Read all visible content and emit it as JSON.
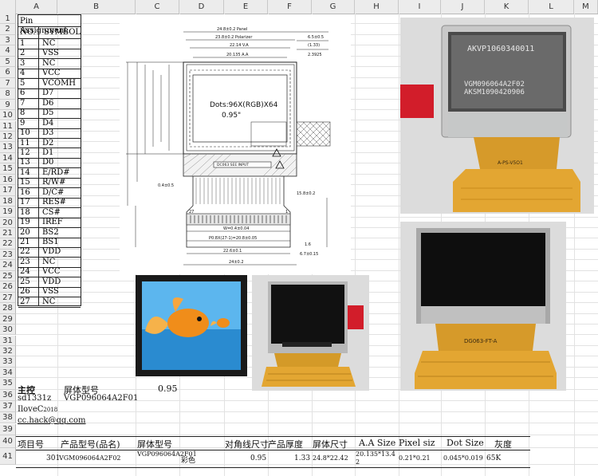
{
  "columns": [
    "A",
    "B",
    "C",
    "D",
    "E",
    "F",
    "G",
    "H",
    "I",
    "J",
    "K",
    "L",
    "M"
  ],
  "rows": [
    "1",
    "2",
    "3",
    "4",
    "5",
    "6",
    "7",
    "8",
    "9",
    "10",
    "11",
    "12",
    "13",
    "14",
    "15",
    "16",
    "17",
    "18",
    "19",
    "20",
    "21",
    "22",
    "23",
    "24",
    "25",
    "26",
    "27",
    "28",
    "29",
    "30",
    "31",
    "32",
    "33",
    "34",
    "35",
    "36",
    "37",
    "38",
    "39",
    "40",
    "41"
  ],
  "pin_table": {
    "title": "Pin Assignment",
    "header_no": "NO.",
    "header_symbol": "SYMBOL",
    "pins": [
      {
        "no": "1",
        "sym": "NC"
      },
      {
        "no": "2",
        "sym": "VSS"
      },
      {
        "no": "3",
        "sym": "NC"
      },
      {
        "no": "4",
        "sym": "VCC"
      },
      {
        "no": "5",
        "sym": "VCOMH"
      },
      {
        "no": "6",
        "sym": "D7"
      },
      {
        "no": "7",
        "sym": "D6"
      },
      {
        "no": "8",
        "sym": "D5"
      },
      {
        "no": "9",
        "sym": "D4"
      },
      {
        "no": "10",
        "sym": "D3"
      },
      {
        "no": "11",
        "sym": "D2"
      },
      {
        "no": "12",
        "sym": "D1"
      },
      {
        "no": "13",
        "sym": "D0"
      },
      {
        "no": "14",
        "sym": "E/RD#"
      },
      {
        "no": "15",
        "sym": "R/W#"
      },
      {
        "no": "16",
        "sym": "D/C#"
      },
      {
        "no": "17",
        "sym": "RES#"
      },
      {
        "no": "18",
        "sym": "CS#"
      },
      {
        "no": "19",
        "sym": "IREF"
      },
      {
        "no": "20",
        "sym": "BS2"
      },
      {
        "no": "21",
        "sym": "BS1"
      },
      {
        "no": "22",
        "sym": "VDD"
      },
      {
        "no": "23",
        "sym": "NC"
      },
      {
        "no": "24",
        "sym": "VCC"
      },
      {
        "no": "25",
        "sym": "VDD"
      },
      {
        "no": "26",
        "sym": "VSS"
      },
      {
        "no": "27",
        "sym": "NC"
      }
    ]
  },
  "drawing": {
    "dim_panel": "24.8±0.2 Panel",
    "dim_polarizer": "23.8±0.2 Polarizer",
    "dim_va": "22.14 V.A",
    "dim_aa": "20.135 A.A",
    "dim_r1": "6.5±0.5",
    "dim_r2": "(1.33)",
    "dim_r3": "2.3925",
    "dots": "Dots:96X(RGB)X64",
    "size": "0.95\"",
    "ic_label": "DC063 SEE INPUT",
    "dim_w1": "W=0.4±0.04",
    "dim_p": "P0.8X(27-1)=20.8±0.05",
    "dim_w2": "22.6±0.1",
    "dim_w3": "24±0.2",
    "dim_side1": "1.6",
    "dim_side2": "6.7±0.15",
    "dim_fpc": "15.8±0.2",
    "dim_stiff": "0.4±0.5",
    "dim_pin27": "27",
    "dim_pin1": "1"
  },
  "photos": {
    "photo1_line1": "AKVP1060340011",
    "photo1_line2": "VGM096064A2F02",
    "photo1_line3": "AKSM1090420906",
    "photo1_fpc": "A-PS-V5O1",
    "photo3_fpc": "DG063-FT-A"
  },
  "cells": {
    "a35": "主控",
    "b35": "屏体型号",
    "c35": "0.95",
    "a36": "sd1331z",
    "b36": "VGP096064A2F01",
    "a37": "IloveC",
    "a37_sup": "2018",
    "a38": "cc.hack@qq.com"
  },
  "spec_table": {
    "headers": [
      "项目号",
      "产品型号(品名)",
      "屏体型号",
      "对角线尺寸",
      "产品厚度",
      "屏体尺寸",
      "A.A Size",
      "Pixel siz",
      "Dot Size",
      "灰度"
    ],
    "row": [
      "301",
      "VGM096064A2F02",
      "VGP096064A2F01",
      "彩色",
      "0.95",
      "1.33",
      "24.8*22.42",
      "20.135*13.42",
      "0.21*0.21",
      "0.045*0.019",
      "65K"
    ]
  }
}
